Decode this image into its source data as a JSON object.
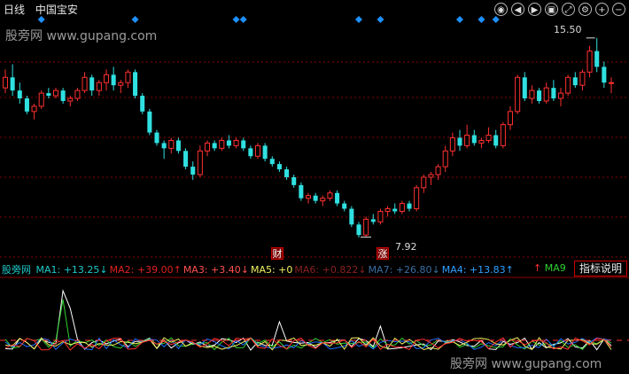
{
  "header": {
    "period": "日线",
    "stock": "中国宝安"
  },
  "watermark": {
    "site": "股旁网",
    "url": "www.gupang.com"
  },
  "toolbar": {
    "icons": [
      "eye-icon",
      "rewind-icon",
      "play-icon",
      "camera-icon",
      "expand-icon",
      "gear-icon",
      "zoom-in-icon",
      "zoom-out-icon"
    ]
  },
  "price_labels": {
    "high": "15.50",
    "low": "7.92"
  },
  "events": {
    "cai": "财",
    "zhang": "涨"
  },
  "legend": {
    "items": [
      {
        "name": "MA1",
        "value": "+13.25",
        "arrow": "↓",
        "color": "#1ec8c8"
      },
      {
        "name": "MA2",
        "value": "+39.00",
        "arrow": "↑",
        "color": "#e02020"
      },
      {
        "name": "MA3",
        "value": "+3.40",
        "arrow": "↓",
        "color": "#ff5050"
      },
      {
        "name": "MA5",
        "value": "+0",
        "arrow": "",
        "color": "#f0f060"
      },
      {
        "name": "MA6",
        "value": "+0.822",
        "arrow": "↓",
        "color": "#8a2020"
      },
      {
        "name": "MA7",
        "value": "+26.80",
        "arrow": "↓",
        "color": "#3a6ea0"
      },
      {
        "name": "MA4",
        "value": "+13.83",
        "arrow": "↑",
        "color": "#30a0ff"
      }
    ],
    "extra_arrow": "↑",
    "ma9": "MA9",
    "button": "指标说明"
  },
  "colors": {
    "up": "#ff3030",
    "down": "#30e0e0",
    "grid": "#8b0000",
    "diamond": "#1e90ff"
  },
  "chart_data": {
    "type": "candlestick",
    "title": "",
    "candles": [
      [
        13.6,
        14.3,
        13.4,
        14.0
      ],
      [
        14.0,
        14.5,
        13.3,
        13.5
      ],
      [
        13.5,
        13.8,
        13.0,
        13.2
      ],
      [
        13.2,
        13.3,
        12.6,
        12.7
      ],
      [
        12.7,
        13.0,
        12.4,
        12.9
      ],
      [
        12.9,
        13.5,
        12.8,
        13.4
      ],
      [
        13.4,
        13.6,
        13.2,
        13.3
      ],
      [
        13.3,
        13.6,
        13.2,
        13.5
      ],
      [
        13.5,
        13.6,
        13.0,
        13.1
      ],
      [
        13.1,
        13.3,
        12.9,
        13.2
      ],
      [
        13.2,
        13.6,
        13.1,
        13.5
      ],
      [
        13.5,
        14.2,
        13.4,
        14.0
      ],
      [
        14.0,
        14.1,
        13.3,
        13.5
      ],
      [
        13.5,
        13.9,
        13.3,
        13.8
      ],
      [
        13.8,
        14.3,
        13.5,
        14.1
      ],
      [
        14.1,
        14.4,
        13.5,
        13.7
      ],
      [
        13.7,
        13.9,
        13.4,
        13.8
      ],
      [
        13.8,
        14.3,
        13.6,
        14.2
      ],
      [
        14.2,
        14.3,
        13.2,
        13.3
      ],
      [
        13.3,
        13.4,
        12.6,
        12.7
      ],
      [
        12.7,
        12.8,
        11.8,
        11.9
      ],
      [
        11.9,
        12.0,
        11.4,
        11.5
      ],
      [
        11.5,
        11.6,
        10.9,
        11.3
      ],
      [
        11.3,
        11.7,
        11.1,
        11.6
      ],
      [
        11.6,
        11.7,
        11.1,
        11.2
      ],
      [
        11.2,
        11.3,
        10.5,
        10.6
      ],
      [
        10.6,
        10.8,
        10.1,
        10.3
      ],
      [
        10.3,
        11.4,
        10.2,
        11.2
      ],
      [
        11.2,
        11.6,
        11.0,
        11.5
      ],
      [
        11.5,
        11.6,
        11.2,
        11.3
      ],
      [
        11.3,
        11.7,
        11.2,
        11.6
      ],
      [
        11.6,
        11.8,
        11.3,
        11.4
      ],
      [
        11.4,
        11.7,
        11.3,
        11.6
      ],
      [
        11.6,
        11.7,
        11.2,
        11.3
      ],
      [
        11.3,
        11.4,
        10.9,
        11.0
      ],
      [
        11.0,
        11.5,
        10.9,
        11.4
      ],
      [
        11.4,
        11.5,
        10.8,
        10.9
      ],
      [
        10.9,
        11.0,
        10.6,
        10.7
      ],
      [
        10.7,
        10.8,
        10.4,
        10.5
      ],
      [
        10.5,
        10.6,
        10.1,
        10.2
      ],
      [
        10.2,
        10.3,
        9.8,
        9.9
      ],
      [
        9.9,
        10.0,
        9.3,
        9.4
      ],
      [
        9.4,
        9.6,
        9.2,
        9.5
      ],
      [
        9.5,
        9.6,
        9.2,
        9.3
      ],
      [
        9.3,
        9.5,
        9.1,
        9.4
      ],
      [
        9.4,
        9.7,
        9.3,
        9.6
      ],
      [
        9.6,
        9.7,
        9.1,
        9.2
      ],
      [
        9.2,
        9.3,
        8.9,
        9.0
      ],
      [
        9.0,
        9.1,
        8.3,
        8.4
      ],
      [
        8.4,
        8.5,
        7.9,
        8.0
      ],
      [
        8.0,
        8.7,
        7.92,
        8.6
      ],
      [
        8.6,
        8.8,
        8.4,
        8.5
      ],
      [
        8.5,
        9.0,
        8.4,
        8.9
      ],
      [
        8.9,
        9.1,
        8.7,
        9.0
      ],
      [
        9.0,
        9.2,
        8.8,
        8.9
      ],
      [
        8.9,
        9.3,
        8.8,
        9.2
      ],
      [
        9.2,
        9.3,
        8.9,
        9.0
      ],
      [
        9.0,
        9.9,
        8.9,
        9.8
      ],
      [
        9.8,
        10.3,
        9.6,
        10.2
      ],
      [
        10.2,
        10.4,
        9.9,
        10.3
      ],
      [
        10.3,
        10.7,
        10.1,
        10.6
      ],
      [
        10.6,
        11.4,
        10.4,
        11.2
      ],
      [
        11.2,
        11.9,
        11.0,
        11.7
      ],
      [
        11.7,
        12.0,
        11.2,
        11.4
      ],
      [
        11.4,
        12.2,
        11.3,
        11.8
      ],
      [
        11.8,
        12.0,
        11.4,
        11.5
      ],
      [
        11.5,
        11.7,
        11.3,
        11.6
      ],
      [
        11.6,
        12.1,
        11.5,
        11.8
      ],
      [
        11.8,
        12.0,
        11.3,
        11.4
      ],
      [
        11.4,
        12.3,
        11.3,
        12.2
      ],
      [
        12.2,
        12.9,
        12.0,
        12.7
      ],
      [
        12.7,
        14.1,
        12.6,
        14.0
      ],
      [
        14.0,
        14.2,
        13.1,
        13.2
      ],
      [
        13.2,
        13.7,
        13.0,
        13.5
      ],
      [
        13.5,
        13.6,
        13.0,
        13.1
      ],
      [
        13.1,
        13.8,
        13.0,
        13.6
      ],
      [
        13.6,
        13.9,
        13.1,
        13.2
      ],
      [
        13.2,
        13.6,
        12.9,
        13.4
      ],
      [
        13.4,
        14.1,
        13.3,
        14.0
      ],
      [
        14.0,
        14.2,
        13.6,
        13.7
      ],
      [
        13.7,
        14.3,
        13.5,
        14.2
      ],
      [
        14.2,
        15.2,
        14.0,
        15.0
      ],
      [
        15.0,
        15.5,
        14.2,
        14.4
      ],
      [
        14.4,
        14.6,
        13.6,
        13.8
      ],
      [
        13.8,
        14.0,
        13.4,
        13.8
      ]
    ],
    "price_range": [
      7.5,
      16.0
    ],
    "marked_high": 15.5,
    "marked_low": 7.92,
    "signal_markers_x": [
      5,
      18,
      32,
      33,
      49,
      52,
      63,
      66,
      68
    ],
    "indicator": {
      "series_names": [
        "MA1",
        "MA2",
        "MA3",
        "MA5",
        "MA6",
        "MA7",
        "MA4"
      ],
      "values": {
        "MA1": 13.25,
        "MA2": 39.0,
        "MA3": 3.4,
        "MA5": 0,
        "MA6": 0.822,
        "MA7": 26.8,
        "MA4": 13.83
      }
    }
  }
}
